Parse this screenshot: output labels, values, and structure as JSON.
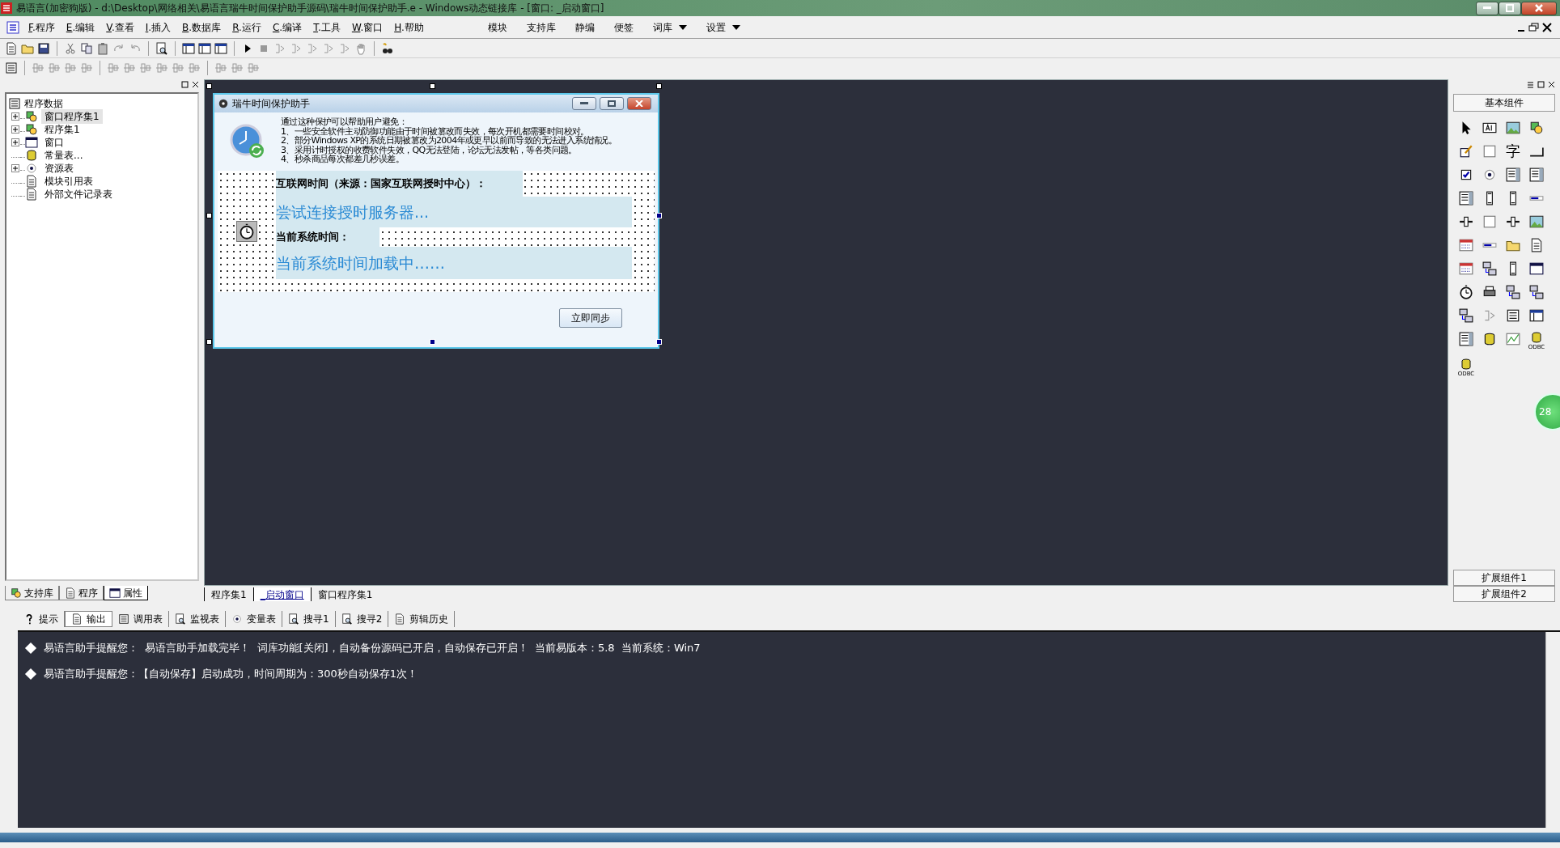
{
  "window": {
    "title": "易语言(加密狗版) - d:\\Desktop\\网络相关\\易语言瑞牛时间保护助手源码\\瑞牛时间保护助手.e - Windows动态链接库 - [窗口: _启动窗口]"
  },
  "menu": [
    {
      "label": "F.程序"
    },
    {
      "label": "E.编辑"
    },
    {
      "label": "V.查看"
    },
    {
      "label": "I.插入"
    },
    {
      "label": "B.数据库"
    },
    {
      "label": "R.运行"
    },
    {
      "label": "C.编译"
    },
    {
      "label": "T.工具"
    },
    {
      "label": "W.窗口"
    },
    {
      "label": "H.帮助"
    }
  ],
  "quick_menu": [
    {
      "label": "模块",
      "dropdown": false
    },
    {
      "label": "支持库",
      "dropdown": false
    },
    {
      "label": "静编",
      "dropdown": false
    },
    {
      "label": "便签",
      "dropdown": false
    },
    {
      "label": "词库",
      "dropdown": true
    },
    {
      "label": "设置",
      "dropdown": true
    }
  ],
  "tree": {
    "label": "程序数据",
    "children": [
      {
        "label": "窗口程序集1",
        "expandable": true,
        "selected": true
      },
      {
        "label": "程序集1",
        "expandable": true,
        "selected": false
      },
      {
        "label": "窗口",
        "expandable": true,
        "selected": false
      },
      {
        "label": "常量表...",
        "expandable": false,
        "selected": false
      },
      {
        "label": "资源表",
        "expandable": true,
        "selected": false
      },
      {
        "label": "模块引用表",
        "expandable": false,
        "selected": false
      },
      {
        "label": "外部文件记录表",
        "expandable": false,
        "selected": false
      }
    ]
  },
  "left_tabs": [
    {
      "label": "支持库",
      "selected": false
    },
    {
      "label": "程序",
      "selected": false
    },
    {
      "label": "属性",
      "selected": true
    }
  ],
  "doc_tabs": [
    {
      "label": "程序集1",
      "selected": false
    },
    {
      "label": "_启动窗口",
      "selected": true
    },
    {
      "label": "窗口程序集1",
      "selected": false
    }
  ],
  "dialog": {
    "title": "瑞牛时间保护助手",
    "intro": [
      "通过这种保护可以帮助用户避免：",
      "1、一些安全软件主动防御功能由于时间被篡改而失效，每次开机都需要时间校对。",
      "2、部分Windows XP的系统日期被篡改为2004年或更早以前而导致的无法进入系统情况。",
      "3、采用计时授权的收费软件失效，QQ无法登陆，论坛无法发帖，等各类问题。",
      "4、秒杀商品每次都差几秒误差。"
    ],
    "internet_label": "互联网时间（来源：国家互联网授时中心）：",
    "internet_value": "尝试连接授时服务器...",
    "system_label": "当前系统时间：",
    "system_value": "当前系统时间加载中……",
    "sync_button": "立即同步"
  },
  "toolbox": {
    "title": "基本组件",
    "char_glyph": "字",
    "odbc_captions": [
      "ODBC",
      "ODBC"
    ],
    "footer": [
      "扩展组件1",
      "扩展组件2"
    ],
    "float_badge": "28"
  },
  "output_tabs": [
    {
      "label": "提示",
      "selected": false
    },
    {
      "label": "输出",
      "selected": true
    },
    {
      "label": "调用表",
      "selected": false
    },
    {
      "label": "监视表",
      "selected": false
    },
    {
      "label": "变量表",
      "selected": false
    },
    {
      "label": "搜寻1",
      "selected": false
    },
    {
      "label": "搜寻2",
      "selected": false
    },
    {
      "label": "剪辑历史",
      "selected": false
    }
  ],
  "output_lines": [
    "易语言助手提醒您：  易语言助手加载完毕！  词库功能[关闭]，自动备份源码已开启，自动保存已开启！  当前易版本：5.8  当前系统：Win7",
    "易语言助手提醒您：【自动保存】启动成功，时间周期为：300秒自动保存1次！"
  ]
}
